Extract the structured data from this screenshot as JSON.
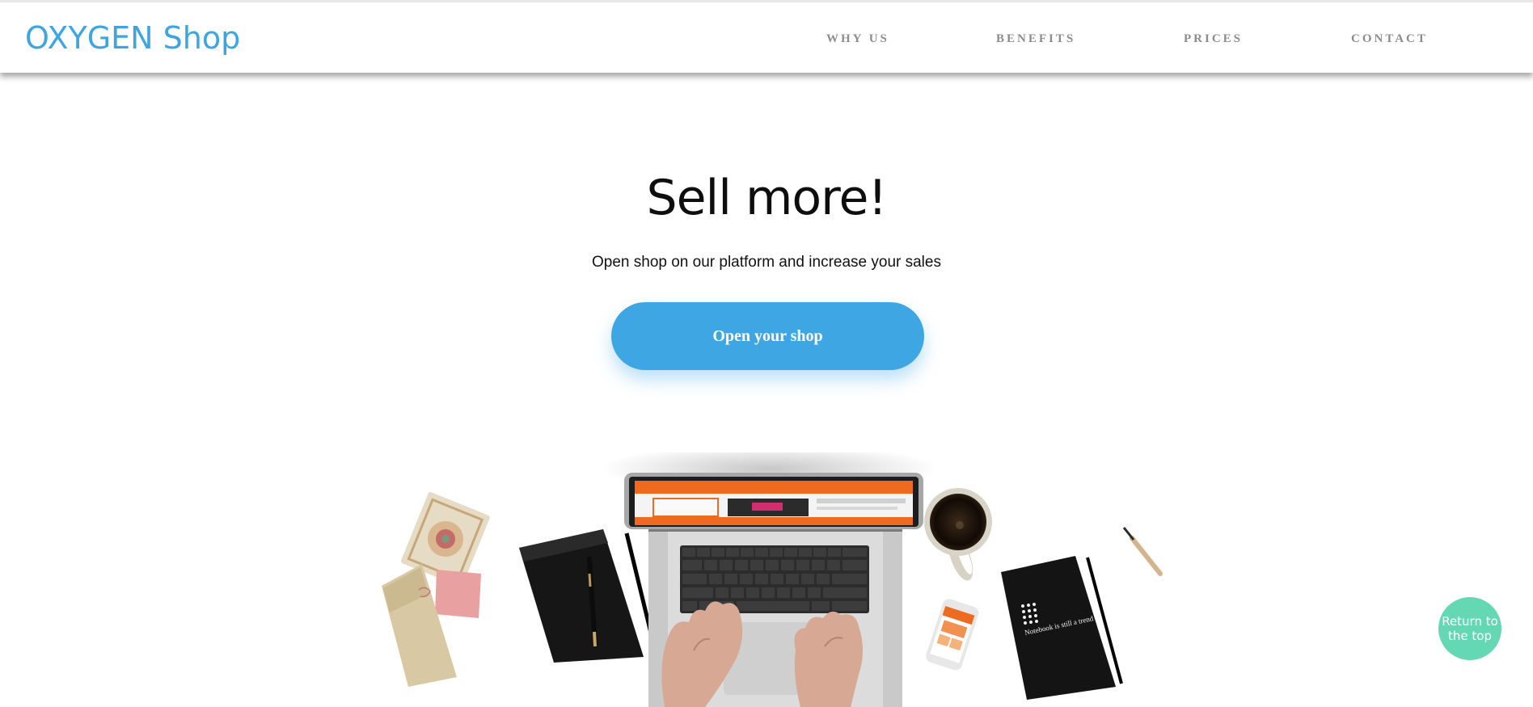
{
  "header": {
    "logo": "OXYGEN Shop",
    "nav": [
      "WHY US",
      "BENEFITS",
      "PRICES",
      "CONTACT"
    ]
  },
  "hero": {
    "title": "Sell more!",
    "subtitle": "Open shop on our platform and increase your sales",
    "cta_label": "Open your shop"
  },
  "illustration": {
    "notebook_text": "Notebook is still a trend"
  },
  "return_top_label": "Return to the top",
  "colors": {
    "brand": "#3ea5e1",
    "cta": "#3fa6e4",
    "return_top": "#63d8b3",
    "nav_text": "#8c8c8c"
  },
  "icons": [
    "laptop-icon",
    "coffee-mug-icon",
    "notebook-icon",
    "pen-icon",
    "phone-icon",
    "greeting-cards-icon"
  ]
}
